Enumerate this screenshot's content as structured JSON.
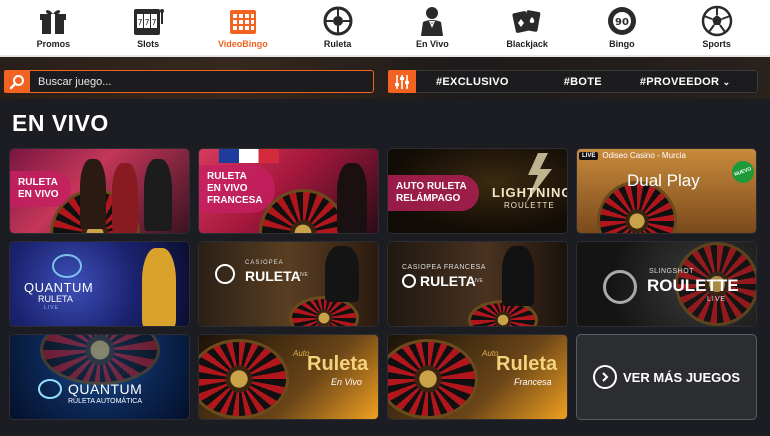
{
  "nav": {
    "items": [
      {
        "label": "Promos",
        "icon": "gift-icon"
      },
      {
        "label": "Slots",
        "icon": "slot-machine-icon"
      },
      {
        "label": "VideoBingo",
        "icon": "bingo-card-icon",
        "active": true
      },
      {
        "label": "Ruleta",
        "icon": "roulette-icon"
      },
      {
        "label": "En Vivo",
        "icon": "dealer-icon"
      },
      {
        "label": "Blackjack",
        "icon": "cards-icon"
      },
      {
        "label": "Bingo",
        "icon": "bingo-ball-icon"
      },
      {
        "label": "Sports",
        "icon": "soccer-ball-icon"
      }
    ]
  },
  "search": {
    "placeholder": "Buscar juego..."
  },
  "filters": {
    "tag1": "#EXCLUSIVO",
    "tag2": "#BOTE",
    "tag3": "#PROVEEDOR"
  },
  "section": {
    "title": "EN VIVO"
  },
  "games": {
    "g1": {
      "line1": "RULETA",
      "line2": "EN VIVO"
    },
    "g2": {
      "line1": "RULETA",
      "line2": "EN VIVO",
      "line3": "FRANCESA"
    },
    "g3": {
      "line1": "AUTO RULETA",
      "line2": "RELÁMPAGO",
      "logo": "LIGHTNING",
      "logo_sub": "ROULETTE"
    },
    "g4": {
      "live_badge": "LIVE",
      "header": "Odiseo Casino - Murcia",
      "title": "Dual Play",
      "new_badge": "NUEVO"
    },
    "g5": {
      "title": "QUANTUM",
      "sub": "RULETA",
      "sub2": "LIVE"
    },
    "g6": {
      "top": "CASIOPEA",
      "title": "RULETA",
      "sub": "LIVE"
    },
    "g7": {
      "top": "CASIOPEA FRANCESA",
      "title": "RULETA",
      "sub": "LIVE"
    },
    "g8": {
      "top": "SLINGSHOT",
      "title": "ROULETTE",
      "sub": "LIVE"
    },
    "g9": {
      "title": "QUANTUM",
      "sub": "RULETA AUTOMÁTICA"
    },
    "g10": {
      "brand": "Auto",
      "title": "Ruleta",
      "sub": "En Vivo"
    },
    "g11": {
      "brand": "Auto",
      "title": "Ruleta",
      "sub": "Francesa"
    },
    "more": {
      "label": "VER MÁS JUEGOS"
    }
  },
  "colors": {
    "accent": "#f26322",
    "pink": "#c42060",
    "bg": "#1b1d22"
  }
}
